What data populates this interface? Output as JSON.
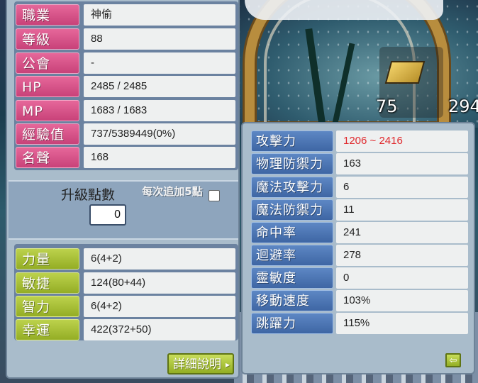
{
  "basic_info": [
    {
      "label": "職業",
      "value": "神偷"
    },
    {
      "label": "等級",
      "value": "88"
    },
    {
      "label": "公會",
      "value": "-"
    },
    {
      "label": "HP",
      "value": "2485 / 2485"
    },
    {
      "label": "MP",
      "value": "1683 / 1683"
    },
    {
      "label": "經驗值",
      "value": "737/5389449(0%)"
    },
    {
      "label": "名聲",
      "value": "168"
    }
  ],
  "ability_points": {
    "label": "升級點數",
    "value": "0",
    "auto_label": "每次追加5點",
    "auto_checked": false
  },
  "primary_stats": [
    {
      "label": "力量",
      "value": "6(4+2)"
    },
    {
      "label": "敏捷",
      "value": "124(80+44)"
    },
    {
      "label": "智力",
      "value": "6(4+2)"
    },
    {
      "label": "幸運",
      "value": "422(372+50)"
    }
  ],
  "detail_button": {
    "label": "詳細說明",
    "arrow": "▸"
  },
  "detail_stats": [
    {
      "label": "攻擊力",
      "value": "1206 ~ 2416",
      "color": "#e0282c"
    },
    {
      "label": "物理防禦力",
      "value": "163"
    },
    {
      "label": "魔法攻擊力",
      "value": "6"
    },
    {
      "label": "魔法防禦力",
      "value": "11"
    },
    {
      "label": "命中率",
      "value": "241"
    },
    {
      "label": "迴避率",
      "value": "278"
    },
    {
      "label": "靈敏度",
      "value": "0"
    },
    {
      "label": "移動速度",
      "value": "103%"
    },
    {
      "label": "跳躍力",
      "value": "115%"
    }
  ],
  "back_button": {
    "glyph": "⇦"
  },
  "quickslot": {
    "counts": [
      "75",
      "294"
    ]
  },
  "colors": {
    "pink": "#d24f85",
    "lime": "#a6bf34",
    "blue": "#4a73b3",
    "panel": "#a9bccb",
    "attack_red": "#e0282c"
  }
}
